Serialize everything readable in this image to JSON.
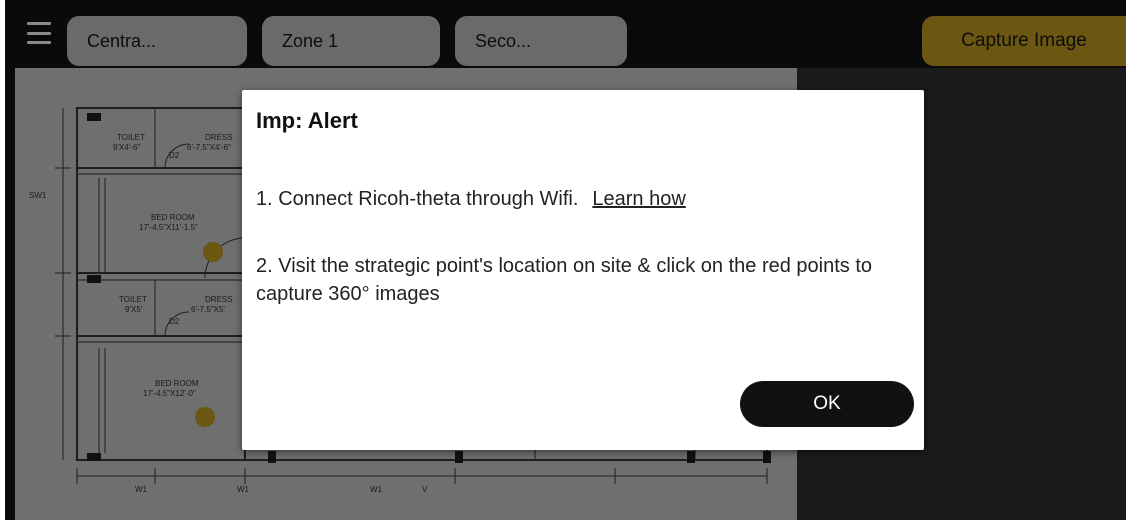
{
  "toolbar": {
    "menu_icon": "hamburger-menu-icon",
    "dropdown_1": "Centra...",
    "dropdown_2": "Zone 1",
    "dropdown_3": "Seco...",
    "capture_label": "Capture Image"
  },
  "floorplan": {
    "labels": {
      "toilet_1": "TOILET",
      "toilet_1_size": "9'X4'-6\"",
      "dress_1": "DRESS",
      "dress_1_size": "6'-7.5\"X4'-6\"",
      "d2_1": "D2",
      "bedroom_1": "BED ROOM",
      "bedroom_1_size": "17'-4.5\"X11'-1.5\"",
      "toilet_2": "TOILET",
      "toilet_2_size": "9'X5'",
      "dress_2": "DRESS",
      "dress_2_size": "6'-7.5\"X5'",
      "d2_2": "D2",
      "bedroom_2": "BED ROOM",
      "bedroom_2_size": "17'-4.5\"X12'-0\"",
      "w1_1": "W1",
      "w1_2": "W1",
      "w1_3": "W1",
      "v_1": "V",
      "sw1": "SW1"
    },
    "marker_color": "#6b5612"
  },
  "dialog": {
    "title": "Imp: Alert",
    "step1": "1. Connect Ricoh-theta through Wifi.",
    "learn_how": "Learn how",
    "step2": "2. Visit the strategic point's location on site & click on the red points to capture 360° images",
    "ok_label": "OK"
  },
  "colors": {
    "accent": "#6b5612",
    "dialog_bg": "#ffffff",
    "ok_bg": "#111111"
  }
}
